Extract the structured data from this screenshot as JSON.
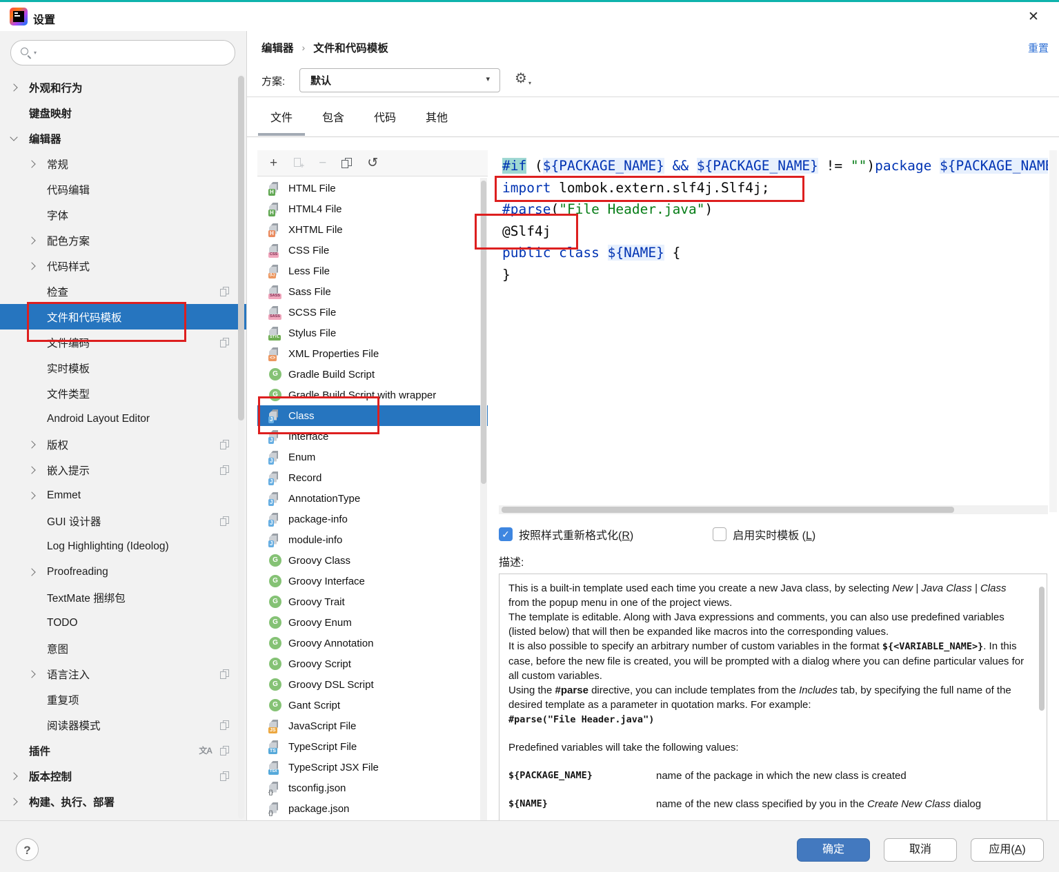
{
  "window": {
    "title": "设置"
  },
  "icons": {
    "close": "✕",
    "help": "?",
    "plus": "+",
    "minus": "−",
    "undo": "↺",
    "gear": "⚙",
    "caret_down": "▾",
    "breadcrumb_sep": "›",
    "translate": "文A",
    "check": "✓",
    "copy_plus": "+"
  },
  "header": {
    "reset_label": "重置"
  },
  "breadcrumb": {
    "parts": [
      "编辑器",
      "文件和代码模板"
    ]
  },
  "scheme": {
    "label": "方案:",
    "value": "默认"
  },
  "tabs": {
    "items": [
      "文件",
      "包含",
      "代码",
      "其他"
    ],
    "active_index": 0
  },
  "sidebar": {
    "items": [
      {
        "id": "appearance-and-behavior",
        "label": "外观和行为",
        "level": 0,
        "chevron": "right"
      },
      {
        "id": "keymap",
        "label": "键盘映射",
        "level": 0,
        "chevron": ""
      },
      {
        "id": "editor",
        "label": "编辑器",
        "level": 0,
        "chevron": "down"
      },
      {
        "id": "general",
        "label": "常规",
        "level": 1,
        "chevron": "right"
      },
      {
        "id": "code-editing",
        "label": "代码编辑",
        "level": 1,
        "chevron": ""
      },
      {
        "id": "font",
        "label": "字体",
        "level": 1,
        "chevron": ""
      },
      {
        "id": "color-scheme",
        "label": "配色方案",
        "level": 1,
        "chevron": "right"
      },
      {
        "id": "code-style",
        "label": "代码样式",
        "level": 1,
        "chevron": "right"
      },
      {
        "id": "inspections",
        "label": "检查",
        "level": 1,
        "chevron": "",
        "icons": [
          "copy"
        ]
      },
      {
        "id": "file-and-code-templates",
        "label": "文件和代码模板",
        "level": 1,
        "chevron": "",
        "selected": true
      },
      {
        "id": "file-encodings",
        "label": "文件编码",
        "level": 1,
        "chevron": "",
        "icons": [
          "copy"
        ]
      },
      {
        "id": "live-templates",
        "label": "实时模板",
        "level": 1,
        "chevron": ""
      },
      {
        "id": "file-types",
        "label": "文件类型",
        "level": 1,
        "chevron": ""
      },
      {
        "id": "android-layout-editor",
        "label": "Android Layout Editor",
        "level": 1,
        "chevron": ""
      },
      {
        "id": "copyright",
        "label": "版权",
        "level": 1,
        "chevron": "right",
        "icons": [
          "copy"
        ]
      },
      {
        "id": "inlay-hints",
        "label": "嵌入提示",
        "level": 1,
        "chevron": "right",
        "icons": [
          "copy"
        ]
      },
      {
        "id": "emmet",
        "label": "Emmet",
        "level": 1,
        "chevron": "right"
      },
      {
        "id": "gui-designer",
        "label": "GUI 设计器",
        "level": 1,
        "chevron": "",
        "icons": [
          "copy"
        ]
      },
      {
        "id": "log-highlighting",
        "label": "Log Highlighting (Ideolog)",
        "level": 1,
        "chevron": ""
      },
      {
        "id": "proofreading",
        "label": "Proofreading",
        "level": 1,
        "chevron": "right"
      },
      {
        "id": "textmate-bundles",
        "label": "TextMate 捆绑包",
        "level": 1,
        "chevron": ""
      },
      {
        "id": "todo",
        "label": "TODO",
        "level": 1,
        "chevron": ""
      },
      {
        "id": "intentions",
        "label": "意图",
        "level": 1,
        "chevron": ""
      },
      {
        "id": "language-injections",
        "label": "语言注入",
        "level": 1,
        "chevron": "right",
        "icons": [
          "copy"
        ]
      },
      {
        "id": "duplicates",
        "label": "重复项",
        "level": 1,
        "chevron": ""
      },
      {
        "id": "reader-mode",
        "label": "阅读器模式",
        "level": 1,
        "chevron": "",
        "icons": [
          "copy"
        ]
      },
      {
        "id": "plugins",
        "label": "插件",
        "level": 0,
        "chevron": "",
        "icons": [
          "translate",
          "copy"
        ]
      },
      {
        "id": "version-control",
        "label": "版本控制",
        "level": 0,
        "chevron": "right",
        "icons": [
          "copy"
        ]
      },
      {
        "id": "build-execution-deployment",
        "label": "构建、执行、部署",
        "level": 0,
        "chevron": "right"
      }
    ]
  },
  "file_list": {
    "items": [
      {
        "id": "html-file",
        "label": "HTML File",
        "icon": "page",
        "tag": "H",
        "bg": "#62a854",
        "fg": "#ffffff"
      },
      {
        "id": "html4-file",
        "label": "HTML4 File",
        "icon": "page",
        "tag": "H",
        "bg": "#62a854",
        "fg": "#ffffff"
      },
      {
        "id": "xhtml-file",
        "label": "XHTML File",
        "icon": "page",
        "tag": "H",
        "bg": "#ea8a5e",
        "fg": "#ffffff"
      },
      {
        "id": "css-file",
        "label": "CSS File",
        "icon": "page",
        "tag": "CSS",
        "bg": "#f0a6bc",
        "fg": "#7d3153"
      },
      {
        "id": "less-file",
        "label": "Less File",
        "icon": "page",
        "tag": "(L)",
        "bg": "#ec9760",
        "fg": "#ffffff"
      },
      {
        "id": "sass-file",
        "label": "Sass File",
        "icon": "page",
        "tag": "SASS",
        "bg": "#f0a6bc",
        "fg": "#7d3153"
      },
      {
        "id": "scss-file",
        "label": "SCSS File",
        "icon": "page",
        "tag": "SASS",
        "bg": "#f0a6bc",
        "fg": "#7d3153"
      },
      {
        "id": "stylus-file",
        "label": "Stylus File",
        "icon": "page",
        "tag": "STYL",
        "bg": "#6fae53",
        "fg": "#ffffff"
      },
      {
        "id": "xml-properties-file",
        "label": "XML Properties File",
        "icon": "page",
        "tag": "<>",
        "bg": "#ec9760",
        "fg": "#ffffff"
      },
      {
        "id": "gradle-build-script",
        "label": "Gradle Build Script",
        "icon": "circle",
        "tag": "G",
        "bg": "#85c275",
        "fg": "#ffffff"
      },
      {
        "id": "gradle-build-script-wrapper",
        "label": "Gradle Build Script with wrapper",
        "icon": "circle",
        "tag": "G",
        "bg": "#85c275",
        "fg": "#ffffff"
      },
      {
        "id": "class",
        "label": "Class",
        "icon": "page",
        "tag": "J",
        "bg": "#66aee2",
        "fg": "#ffffff",
        "selected": true
      },
      {
        "id": "interface",
        "label": "Interface",
        "icon": "page",
        "tag": "J",
        "bg": "#66aee2",
        "fg": "#ffffff"
      },
      {
        "id": "enum",
        "label": "Enum",
        "icon": "page",
        "tag": "J",
        "bg": "#66aee2",
        "fg": "#ffffff"
      },
      {
        "id": "record",
        "label": "Record",
        "icon": "page",
        "tag": "J",
        "bg": "#66aee2",
        "fg": "#ffffff"
      },
      {
        "id": "annotationtype",
        "label": "AnnotationType",
        "icon": "page",
        "tag": "J",
        "bg": "#66aee2",
        "fg": "#ffffff"
      },
      {
        "id": "package-info",
        "label": "package-info",
        "icon": "page",
        "tag": "J",
        "bg": "#66aee2",
        "fg": "#ffffff"
      },
      {
        "id": "module-info",
        "label": "module-info",
        "icon": "page",
        "tag": "J",
        "bg": "#66aee2",
        "fg": "#ffffff"
      },
      {
        "id": "groovy-class",
        "label": "Groovy Class",
        "icon": "circle",
        "tag": "G",
        "bg": "#85c275",
        "fg": "#ffffff"
      },
      {
        "id": "groovy-interface",
        "label": "Groovy Interface",
        "icon": "circle",
        "tag": "G",
        "bg": "#85c275",
        "fg": "#ffffff"
      },
      {
        "id": "groovy-trait",
        "label": "Groovy Trait",
        "icon": "circle",
        "tag": "G",
        "bg": "#85c275",
        "fg": "#ffffff"
      },
      {
        "id": "groovy-enum",
        "label": "Groovy Enum",
        "icon": "circle",
        "tag": "G",
        "bg": "#85c275",
        "fg": "#ffffff"
      },
      {
        "id": "groovy-annotation",
        "label": "Groovy Annotation",
        "icon": "circle",
        "tag": "G",
        "bg": "#85c275",
        "fg": "#ffffff"
      },
      {
        "id": "groovy-script",
        "label": "Groovy Script",
        "icon": "circle",
        "tag": "G",
        "bg": "#85c275",
        "fg": "#ffffff"
      },
      {
        "id": "groovy-dsl-script",
        "label": "Groovy DSL Script",
        "icon": "circle",
        "tag": "G",
        "bg": "#85c275",
        "fg": "#ffffff"
      },
      {
        "id": "gant-script",
        "label": "Gant Script",
        "icon": "circle",
        "tag": "G",
        "bg": "#85c275",
        "fg": "#ffffff"
      },
      {
        "id": "javascript-file",
        "label": "JavaScript File",
        "icon": "page",
        "tag": "JS",
        "bg": "#eca73f",
        "fg": "#ffffff"
      },
      {
        "id": "typescript-file",
        "label": "TypeScript File",
        "icon": "page",
        "tag": "TS",
        "bg": "#56a9da",
        "fg": "#ffffff"
      },
      {
        "id": "typescript-jsx-file",
        "label": "TypeScript JSX File",
        "icon": "page",
        "tag": "TSX",
        "bg": "#56a9da",
        "fg": "#ffffff"
      },
      {
        "id": "tsconfig-json",
        "label": "tsconfig.json",
        "icon": "page",
        "tag": "{}",
        "bg": "",
        "fg": "#6f7479"
      },
      {
        "id": "package-json",
        "label": "package.json",
        "icon": "page",
        "tag": "{}",
        "bg": "",
        "fg": "#6f7479"
      }
    ]
  },
  "editor": {
    "lines": [
      [
        [
          "dirhl",
          "#if"
        ],
        [
          "p",
          " ("
        ],
        [
          "var",
          "${PACKAGE_NAME}"
        ],
        [
          "p",
          " "
        ],
        [
          "kw",
          "&&"
        ],
        [
          "p",
          " "
        ],
        [
          "var",
          "${PACKAGE_NAME}"
        ],
        [
          "p",
          " != "
        ],
        [
          "str",
          "\"\""
        ],
        [
          "p",
          ")"
        ],
        [
          "kw",
          "package"
        ],
        [
          "p",
          " "
        ],
        [
          "var",
          "${PACKAGE_NAME}"
        ]
      ],
      [
        [
          "kw",
          "import"
        ],
        [
          "p",
          " lombok.extern.slf4j.Slf4j;"
        ]
      ],
      [
        [
          "diru",
          "#parse"
        ],
        [
          "p",
          "("
        ],
        [
          "str",
          "\"File Header.java\""
        ],
        [
          "p",
          ")"
        ]
      ],
      [
        [
          "p",
          "@Slf4j"
        ]
      ],
      [
        [
          "kw",
          "public class"
        ],
        [
          "p",
          " "
        ],
        [
          "var",
          "${NAME}"
        ],
        [
          "p",
          " {"
        ]
      ],
      [
        [
          "p",
          "}"
        ]
      ]
    ]
  },
  "options": {
    "reformat": {
      "pre": "按照样式重新格式化(",
      "key": "R",
      "post": ")",
      "checked": true
    },
    "live_template": {
      "pre": "启用实时模板 (",
      "key": "L",
      "post": ")",
      "checked": false
    }
  },
  "description": {
    "label": "描述:",
    "paragraphs": [
      {
        "spans": [
          [
            "t",
            "This is a built-in template used each time you create a new Java class, by selecting "
          ],
          [
            "i",
            "New | Java Class | Class"
          ],
          [
            "t",
            " from the popup menu in one of the project views."
          ]
        ]
      },
      {
        "spans": [
          [
            "t",
            "The template is editable. Along with Java expressions and comments, you can also use predefined variables (listed below) that will then be expanded like macros into the corresponding values."
          ]
        ]
      },
      {
        "spans": [
          [
            "t",
            "It is also possible to specify an arbitrary number of custom variables in the format "
          ],
          [
            "bm",
            "${<VARIABLE_NAME>}"
          ],
          [
            "t",
            ". In this case, before the new file is created, you will be prompted with a dialog where you can define particular values for all custom variables."
          ]
        ]
      },
      {
        "spans": [
          [
            "t",
            "Using the "
          ],
          [
            "b",
            "#parse"
          ],
          [
            "t",
            " directive, you can include templates from the "
          ],
          [
            "i",
            "Includes"
          ],
          [
            "t",
            " tab, by specifying the full name of the desired template as a parameter in quotation marks. For example:"
          ]
        ]
      },
      {
        "spans": [
          [
            "bm",
            "#parse(\"File Header.java\")"
          ]
        ]
      },
      {
        "gap": true
      },
      {
        "spans": [
          [
            "t",
            "Predefined variables will take the following values:"
          ]
        ]
      }
    ],
    "variables": [
      {
        "name": "${PACKAGE_NAME}",
        "spans": [
          [
            "t",
            "name of the package in which the new class is created"
          ]
        ]
      },
      {
        "name": "${NAME}",
        "spans": [
          [
            "t",
            "name of the new class specified by you in the "
          ],
          [
            "i",
            "Create New Class"
          ],
          [
            "t",
            " dialog"
          ]
        ]
      }
    ]
  },
  "buttons": {
    "ok": "确定",
    "cancel": "取消",
    "apply_pre": "应用(",
    "apply_key": "A",
    "apply_post": ")"
  }
}
